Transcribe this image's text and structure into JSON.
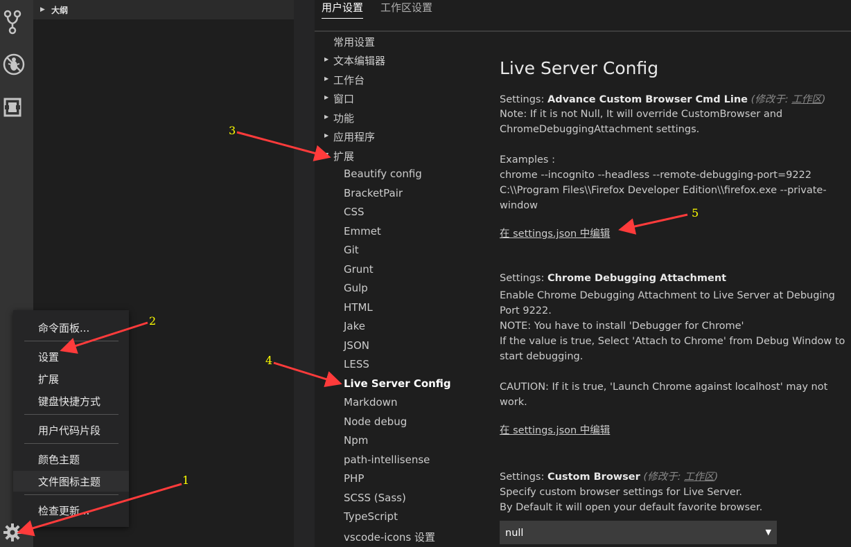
{
  "sidebar": {
    "outline_label": "大纲"
  },
  "tabs": [
    {
      "label": "用户设置"
    },
    {
      "label": "工作区设置"
    }
  ],
  "toc": [
    {
      "label": "常用设置",
      "expandable": false
    },
    {
      "label": "文本编辑器",
      "expandable": true
    },
    {
      "label": "工作台",
      "expandable": true
    },
    {
      "label": "窗口",
      "expandable": true
    },
    {
      "label": "功能",
      "expandable": true
    },
    {
      "label": "应用程序",
      "expandable": true
    },
    {
      "label": "扩展",
      "expandable": true
    },
    {
      "label": "Beautify config"
    },
    {
      "label": "BracketPair"
    },
    {
      "label": "CSS"
    },
    {
      "label": "Emmet"
    },
    {
      "label": "Git"
    },
    {
      "label": "Grunt"
    },
    {
      "label": "Gulp"
    },
    {
      "label": "HTML"
    },
    {
      "label": "Jake"
    },
    {
      "label": "JSON"
    },
    {
      "label": "LESS"
    },
    {
      "label": "Live Server Config",
      "selected": true
    },
    {
      "label": "Markdown"
    },
    {
      "label": "Node debug"
    },
    {
      "label": "Npm"
    },
    {
      "label": "path-intellisense"
    },
    {
      "label": "PHP"
    },
    {
      "label": "SCSS (Sass)"
    },
    {
      "label": "TypeScript"
    },
    {
      "label": "vscode-icons 设置"
    }
  ],
  "content": {
    "heading": "Live Server Config",
    "settings": [
      {
        "prefix": "Settings: ",
        "name": "Advance Custom Browser Cmd Line",
        "modified_prefix": "(修改于: ",
        "modified_scope": "工作区",
        "modified_suffix": ")",
        "lines": [
          "Note: If it is not Null, It will override CustomBrowser and",
          "ChromeDebuggingAttachment settings.",
          "",
          "Examples :",
          "chrome --incognito --headless --remote-debugging-port=9222",
          "C:\\\\Program Files\\\\Firefox Developer Edition\\\\firefox.exe --private-",
          "window"
        ],
        "edit_link": "在 settings.json 中编辑"
      },
      {
        "prefix": "Settings: ",
        "name": "Chrome Debugging Attachment",
        "lines": [
          "Enable Chrome Debugging Attachment to Live Server at Debuging",
          "Port 9222.",
          "NOTE: You have to install 'Debugger for Chrome'",
          "If the value is true, Select 'Attach to Chrome' from Debug Window to",
          "start debugging.",
          "",
          "CAUTION: If it is true, 'Launch Chrome against localhost' may not",
          "work."
        ],
        "edit_link": "在 settings.json 中编辑"
      },
      {
        "prefix": "Settings: ",
        "name": "Custom Browser",
        "modified_prefix": "(修改于: ",
        "modified_scope": "工作区",
        "modified_suffix": ")",
        "lines": [
          "Specify custom browser settings for Live Server.",
          "By Default it will open your default favorite browser."
        ],
        "select_value": "null"
      }
    ]
  },
  "menu": {
    "items": [
      {
        "label": "命令面板..."
      },
      {
        "label": "设置"
      },
      {
        "label": "扩展"
      },
      {
        "label": "键盘快捷方式"
      },
      {
        "label": "用户代码片段"
      },
      {
        "label": "颜色主题"
      },
      {
        "label": "文件图标主题",
        "hover": true
      },
      {
        "label": "检查更新..."
      }
    ]
  },
  "annotations": [
    "1",
    "2",
    "3",
    "4",
    "5"
  ],
  "colors": {
    "arrow": "#ff3b3b",
    "annotation_number": "#ffff00",
    "activity_bar": "#333333",
    "editor_bg": "#1e1e1e"
  },
  "icons": [
    "source-control-icon",
    "debug-icon",
    "extensions-icon",
    "gear-icon"
  ]
}
